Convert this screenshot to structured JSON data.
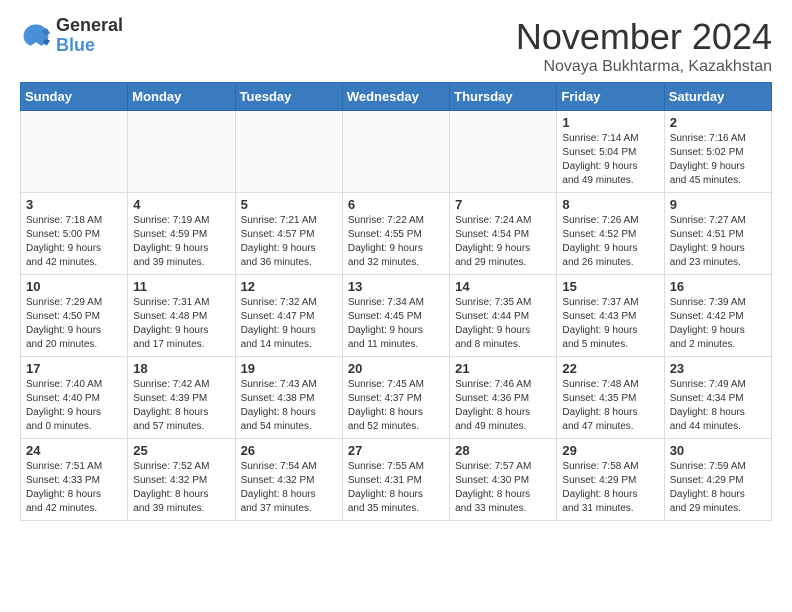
{
  "header": {
    "logo_general": "General",
    "logo_blue": "Blue",
    "month_title": "November 2024",
    "location": "Novaya Bukhtarma, Kazakhstan"
  },
  "days_of_week": [
    "Sunday",
    "Monday",
    "Tuesday",
    "Wednesday",
    "Thursday",
    "Friday",
    "Saturday"
  ],
  "weeks": [
    [
      {
        "day": "",
        "info": "",
        "empty": true
      },
      {
        "day": "",
        "info": "",
        "empty": true
      },
      {
        "day": "",
        "info": "",
        "empty": true
      },
      {
        "day": "",
        "info": "",
        "empty": true
      },
      {
        "day": "",
        "info": "",
        "empty": true
      },
      {
        "day": "1",
        "info": "Sunrise: 7:14 AM\nSunset: 5:04 PM\nDaylight: 9 hours\nand 49 minutes."
      },
      {
        "day": "2",
        "info": "Sunrise: 7:16 AM\nSunset: 5:02 PM\nDaylight: 9 hours\nand 45 minutes."
      }
    ],
    [
      {
        "day": "3",
        "info": "Sunrise: 7:18 AM\nSunset: 5:00 PM\nDaylight: 9 hours\nand 42 minutes."
      },
      {
        "day": "4",
        "info": "Sunrise: 7:19 AM\nSunset: 4:59 PM\nDaylight: 9 hours\nand 39 minutes."
      },
      {
        "day": "5",
        "info": "Sunrise: 7:21 AM\nSunset: 4:57 PM\nDaylight: 9 hours\nand 36 minutes."
      },
      {
        "day": "6",
        "info": "Sunrise: 7:22 AM\nSunset: 4:55 PM\nDaylight: 9 hours\nand 32 minutes."
      },
      {
        "day": "7",
        "info": "Sunrise: 7:24 AM\nSunset: 4:54 PM\nDaylight: 9 hours\nand 29 minutes."
      },
      {
        "day": "8",
        "info": "Sunrise: 7:26 AM\nSunset: 4:52 PM\nDaylight: 9 hours\nand 26 minutes."
      },
      {
        "day": "9",
        "info": "Sunrise: 7:27 AM\nSunset: 4:51 PM\nDaylight: 9 hours\nand 23 minutes."
      }
    ],
    [
      {
        "day": "10",
        "info": "Sunrise: 7:29 AM\nSunset: 4:50 PM\nDaylight: 9 hours\nand 20 minutes."
      },
      {
        "day": "11",
        "info": "Sunrise: 7:31 AM\nSunset: 4:48 PM\nDaylight: 9 hours\nand 17 minutes."
      },
      {
        "day": "12",
        "info": "Sunrise: 7:32 AM\nSunset: 4:47 PM\nDaylight: 9 hours\nand 14 minutes."
      },
      {
        "day": "13",
        "info": "Sunrise: 7:34 AM\nSunset: 4:45 PM\nDaylight: 9 hours\nand 11 minutes."
      },
      {
        "day": "14",
        "info": "Sunrise: 7:35 AM\nSunset: 4:44 PM\nDaylight: 9 hours\nand 8 minutes."
      },
      {
        "day": "15",
        "info": "Sunrise: 7:37 AM\nSunset: 4:43 PM\nDaylight: 9 hours\nand 5 minutes."
      },
      {
        "day": "16",
        "info": "Sunrise: 7:39 AM\nSunset: 4:42 PM\nDaylight: 9 hours\nand 2 minutes."
      }
    ],
    [
      {
        "day": "17",
        "info": "Sunrise: 7:40 AM\nSunset: 4:40 PM\nDaylight: 9 hours\nand 0 minutes."
      },
      {
        "day": "18",
        "info": "Sunrise: 7:42 AM\nSunset: 4:39 PM\nDaylight: 8 hours\nand 57 minutes."
      },
      {
        "day": "19",
        "info": "Sunrise: 7:43 AM\nSunset: 4:38 PM\nDaylight: 8 hours\nand 54 minutes."
      },
      {
        "day": "20",
        "info": "Sunrise: 7:45 AM\nSunset: 4:37 PM\nDaylight: 8 hours\nand 52 minutes."
      },
      {
        "day": "21",
        "info": "Sunrise: 7:46 AM\nSunset: 4:36 PM\nDaylight: 8 hours\nand 49 minutes."
      },
      {
        "day": "22",
        "info": "Sunrise: 7:48 AM\nSunset: 4:35 PM\nDaylight: 8 hours\nand 47 minutes."
      },
      {
        "day": "23",
        "info": "Sunrise: 7:49 AM\nSunset: 4:34 PM\nDaylight: 8 hours\nand 44 minutes."
      }
    ],
    [
      {
        "day": "24",
        "info": "Sunrise: 7:51 AM\nSunset: 4:33 PM\nDaylight: 8 hours\nand 42 minutes."
      },
      {
        "day": "25",
        "info": "Sunrise: 7:52 AM\nSunset: 4:32 PM\nDaylight: 8 hours\nand 39 minutes."
      },
      {
        "day": "26",
        "info": "Sunrise: 7:54 AM\nSunset: 4:32 PM\nDaylight: 8 hours\nand 37 minutes."
      },
      {
        "day": "27",
        "info": "Sunrise: 7:55 AM\nSunset: 4:31 PM\nDaylight: 8 hours\nand 35 minutes."
      },
      {
        "day": "28",
        "info": "Sunrise: 7:57 AM\nSunset: 4:30 PM\nDaylight: 8 hours\nand 33 minutes."
      },
      {
        "day": "29",
        "info": "Sunrise: 7:58 AM\nSunset: 4:29 PM\nDaylight: 8 hours\nand 31 minutes."
      },
      {
        "day": "30",
        "info": "Sunrise: 7:59 AM\nSunset: 4:29 PM\nDaylight: 8 hours\nand 29 minutes."
      }
    ]
  ]
}
